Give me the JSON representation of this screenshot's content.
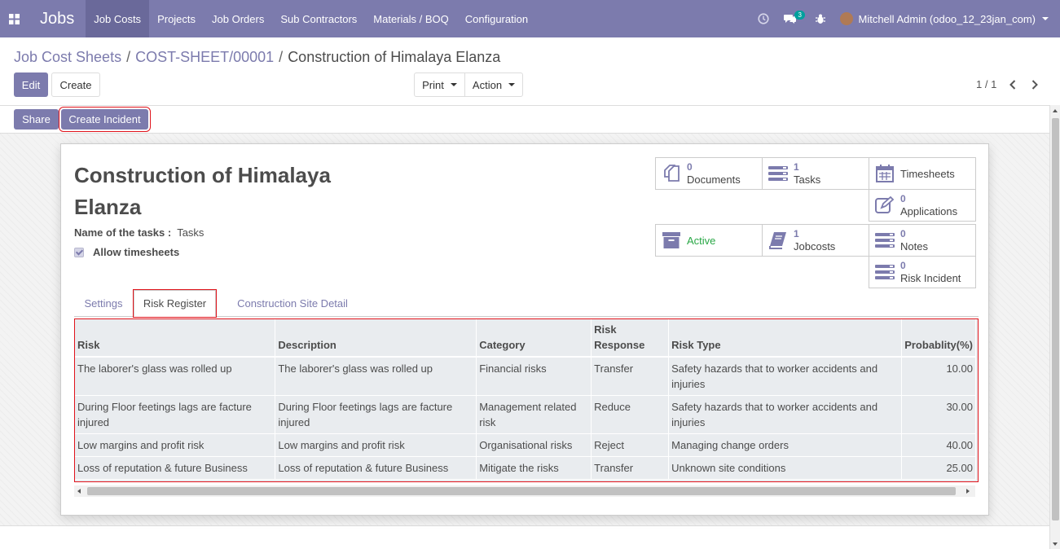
{
  "navbar": {
    "brand": "Jobs",
    "menu": [
      "Job Costs",
      "Projects",
      "Job Orders",
      "Sub Contractors",
      "Materials / BOQ",
      "Configuration"
    ],
    "messages_count": "3",
    "user": "Mitchell Admin (odoo_12_23jan_com)"
  },
  "breadcrumb": {
    "items": [
      "Job Cost Sheets",
      "COST-SHEET/00001",
      "Construction of Himalaya Elanza"
    ],
    "separator": "/"
  },
  "buttons": {
    "edit": "Edit",
    "create": "Create",
    "print": "Print",
    "action": "Action",
    "share": "Share",
    "create_incident": "Create Incident"
  },
  "pager": {
    "value": "1 / 1"
  },
  "record": {
    "title_line1": "Construction of Himalaya",
    "title_line2": "Elanza",
    "tasks_label": "Name of the tasks :",
    "tasks_value": "Tasks",
    "allow_timesheets": "Allow timesheets"
  },
  "smart_buttons": {
    "documents": {
      "count": "0",
      "label": "Documents"
    },
    "tasks": {
      "count": "1",
      "label": "Tasks"
    },
    "timesheets": {
      "label": "Timesheets"
    },
    "applications": {
      "count": "0",
      "label": "Applications"
    },
    "active": {
      "label": "Active"
    },
    "jobcosts": {
      "count": "1",
      "label": "Jobcosts"
    },
    "notes": {
      "count": "0",
      "label": "Notes"
    },
    "risk_incident": {
      "count": "0",
      "label": "Risk Incident"
    }
  },
  "tabs": [
    "Settings",
    "Risk Register",
    "Construction Site Detail"
  ],
  "risk_table": {
    "headers": [
      "Risk",
      "Description",
      "Category",
      "Risk Response",
      "Risk Type",
      "Probablity(%)"
    ],
    "rows": [
      [
        "The laborer's glass was rolled up",
        "The laborer's glass was rolled up",
        "Financial risks",
        "Transfer",
        "Safety hazards that to worker accidents and injuries",
        "10.00"
      ],
      [
        "During Floor feetings lags are facture injured",
        "During Floor feetings lags are facture injured",
        "Management related risk",
        "Reduce",
        "Safety hazards that to worker accidents and injuries",
        "30.00"
      ],
      [
        "Low margins and profit risk",
        "Low margins and profit risk",
        "Organisational risks",
        "Reject",
        "Managing change orders",
        "40.00"
      ],
      [
        "Loss of reputation & future Business",
        "Loss of reputation & future Business",
        "Mitigate the risks",
        "Transfer",
        "Unknown site conditions",
        "25.00"
      ]
    ]
  },
  "colors": {
    "brand": "#7c7bad",
    "highlight": "#e0131b",
    "active_green": "#28a745"
  }
}
